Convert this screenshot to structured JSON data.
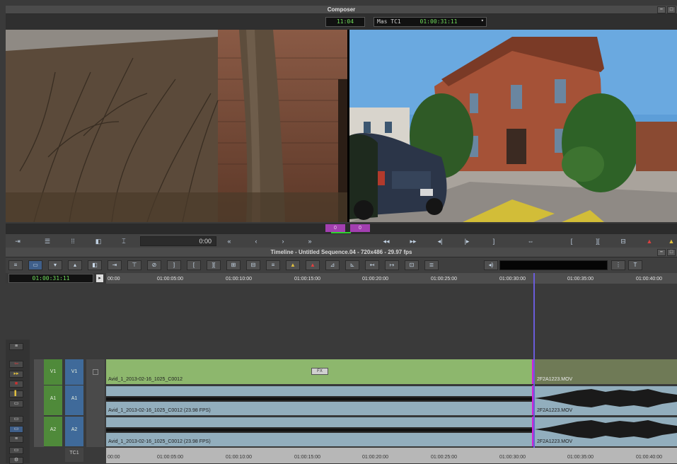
{
  "composer": {
    "title": "Composer",
    "tc_left": "11:04",
    "tc_label": "Mas TC1",
    "tc_right": "01:00:31:11"
  },
  "position_bar": {
    "marker1": "0",
    "marker2": "0"
  },
  "monitor_toolbar": {
    "time_value": "0:00"
  },
  "timeline": {
    "title": "Timeline - Untitled Sequence.04 - 720x486 - 29.97 fps",
    "current_tc": "01:00:31:11",
    "ruler_ticks": [
      "00:00",
      "01:00:05:00",
      "01:00:10:00",
      "01:00:15:00",
      "01:00:20:00",
      "01:00:25:00",
      "01:00:30:00",
      "01:00:35:00",
      "01:00:40:00"
    ],
    "tracks": {
      "v1_source": "V1",
      "v1_record": "V1",
      "a1_source": "A1",
      "a1_record": "A1",
      "a2_source": "A2",
      "a2_record": "A2",
      "tc1": "TC1"
    },
    "clips": {
      "v1_main": "Avid_1_2013-02-16_1025_C0012",
      "v1_second": "2F2A1223.MOV",
      "a1_main": "Avid_1_2013-02-16_1025_C0012 (23.98 FPS)",
      "a1_second": "2F2A1223.MOV",
      "a2_main": "Avid_1_2013-02-16_1025_C0012 (23.98 FPS)",
      "a2_second": "2F2A1223.MOV",
      "fx_badge": "FX"
    }
  },
  "colors": {
    "video_clip": "#8db76d",
    "audio_clip": "#92aebd",
    "playhead": "#6a5cd9",
    "edit_marker": "#d324d6",
    "timecode_green": "#6fdc5a"
  }
}
